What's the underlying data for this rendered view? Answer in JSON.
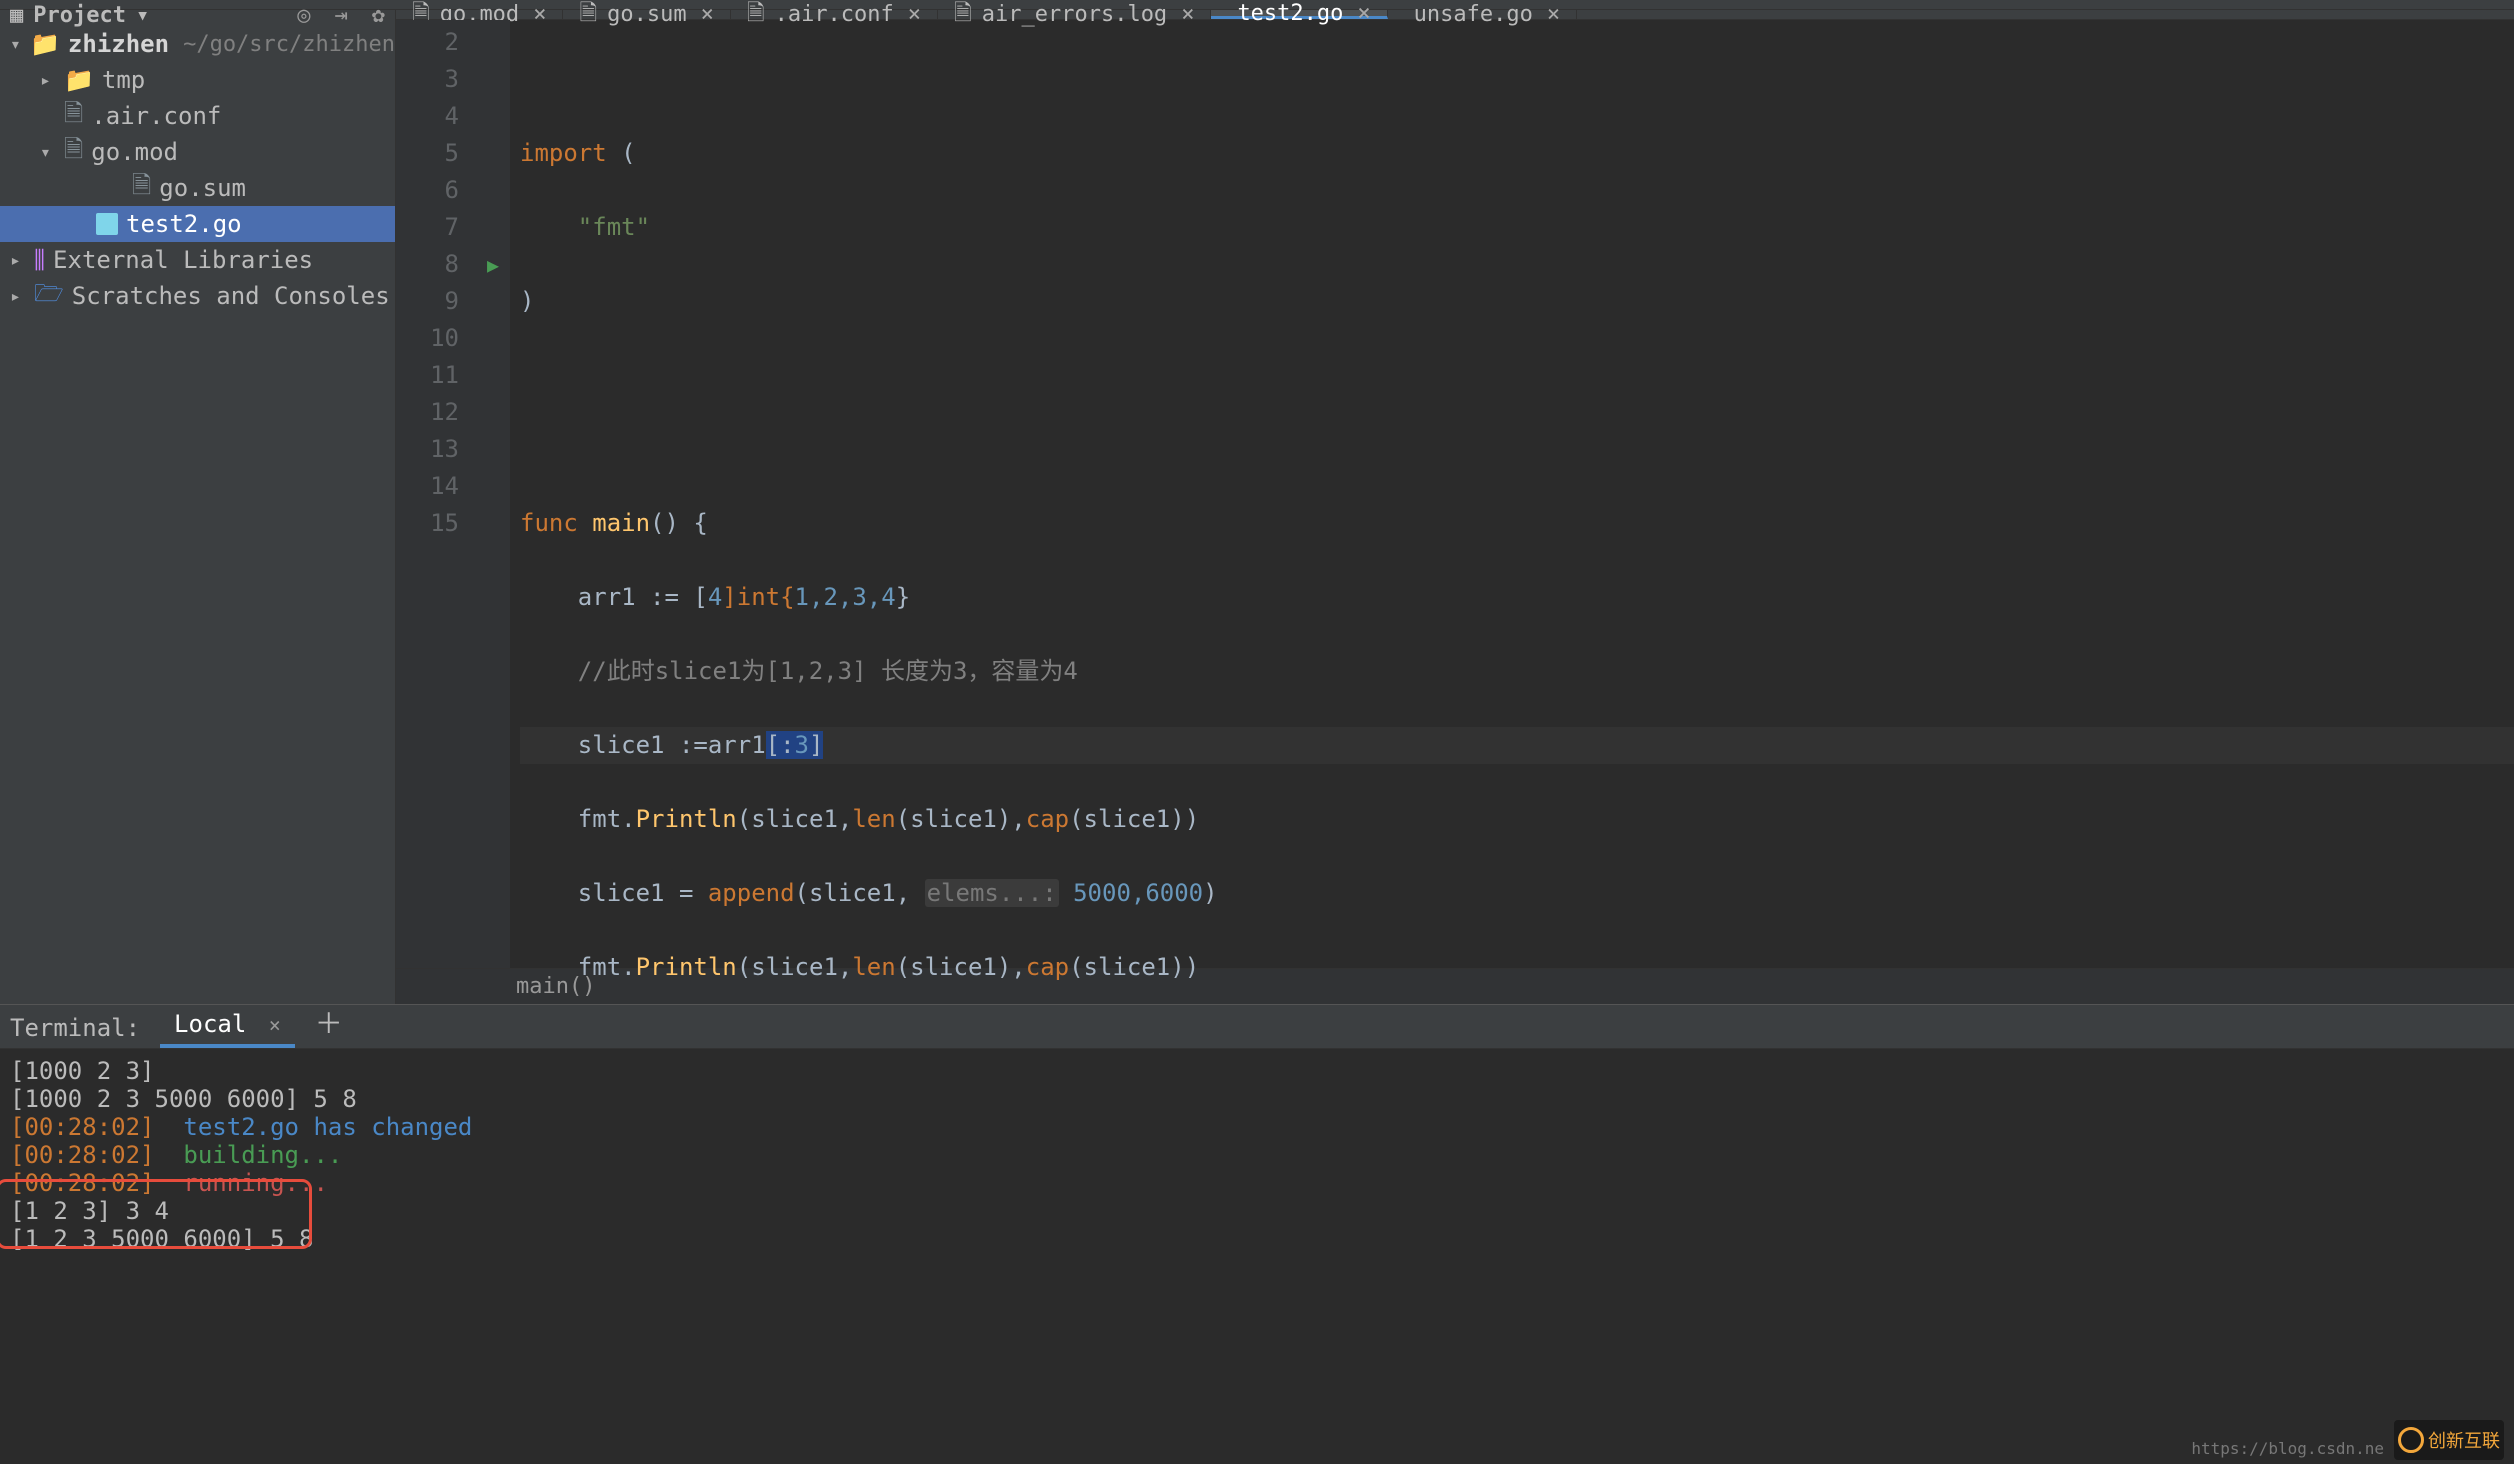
{
  "sidebar": {
    "project_label": "Project",
    "root": {
      "name": "zhizhen",
      "path": "~/go/src/zhizhen"
    },
    "items": [
      {
        "name": "tmp",
        "type": "folder"
      },
      {
        "name": ".air.conf",
        "type": "file"
      },
      {
        "name": "go.mod",
        "type": "file",
        "expanded": true
      },
      {
        "name": "go.sum",
        "type": "file"
      },
      {
        "name": "test2.go",
        "type": "go",
        "selected": true
      }
    ],
    "external": "External Libraries",
    "scratch": "Scratches and Consoles"
  },
  "tabs": [
    {
      "label": "go.mod",
      "icon": "file"
    },
    {
      "label": "go.sum",
      "icon": "file"
    },
    {
      "label": ".air.conf",
      "icon": "file"
    },
    {
      "label": "air_errors.log",
      "icon": "file"
    },
    {
      "label": "test2.go",
      "icon": "go",
      "active": true
    },
    {
      "label": "unsafe.go",
      "icon": "go"
    }
  ],
  "code": {
    "lines": [
      "2",
      "3",
      "4",
      "5",
      "6",
      "7",
      "8",
      "9",
      "10",
      "11",
      "12",
      "13",
      "14",
      "15"
    ],
    "l3_kw": "import",
    "l3_paren": " (",
    "l4_str": "\"fmt\"",
    "l5_paren": ")",
    "l8_kw": "func ",
    "l8_fn": "main",
    "l8_rest": "() {",
    "l9_arr": "arr1 := [",
    "l9_num4": "4",
    "l9_int": "]int{",
    "l9_nums": "1,2,3,4",
    "l9_close": "}",
    "l10_cmt": "//此时slice1为[1,2,3] 长度为3，容量为4",
    "l11_a": "slice1 :=arr1",
    "l11_b": "[:",
    "l11_c": "3",
    "l11_d": "]",
    "l12_a": "fmt.",
    "l12_fn": "Println",
    "l12_b": "(slice1,",
    "l12_len": "len",
    "l12_c": "(slice1),",
    "l12_cap": "cap",
    "l12_d": "(slice1))",
    "l13_a": "slice1 = ",
    "l13_fn": "append",
    "l13_b": "(slice1, ",
    "l13_hint": "elems...:",
    "l13_nums": " 5000,6000",
    "l13_c": ")",
    "l14_a": "fmt.",
    "l14_fn": "Println",
    "l14_b": "(slice1,",
    "l14_len": "len",
    "l14_c": "(slice1),",
    "l14_cap": "cap",
    "l14_d": "(slice1))"
  },
  "breadcrumb": "main()",
  "terminal": {
    "title": "Terminal:",
    "tab": "Local",
    "lines": [
      {
        "text": "[1000 2 3]"
      },
      {
        "text": "[1000 2 3 5000 6000] 5 8"
      },
      {
        "ts": "[00:28:02]",
        "file": "  test2.go has changed"
      },
      {
        "ts": "[00:28:02]",
        "build": "  building..."
      },
      {
        "ts": "[00:28:02]",
        "run": "  running..."
      },
      {
        "text": "[1 2 3] 3 4"
      },
      {
        "text": "[1 2 3 5000 6000] 5 8"
      }
    ]
  },
  "watermark": "https://blog.csdn.ne",
  "logo": "创新互联"
}
